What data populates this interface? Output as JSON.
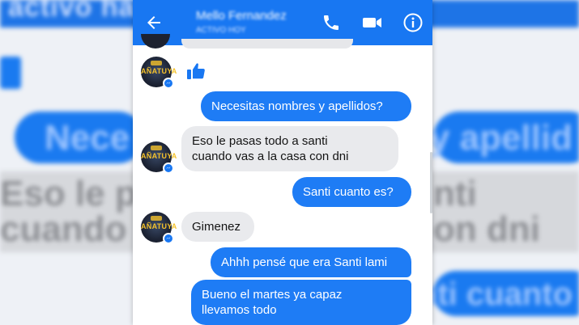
{
  "header": {
    "contact_name": "Mello Fernandez",
    "contact_status": "ACTIVO HOY"
  },
  "background": {
    "top_text": "activo hace",
    "echo_blue_left": "Nece",
    "echo_blue_right": "y apellid",
    "echo_grey_left_1": "Eso le pa",
    "echo_grey_left_2": "cuando v",
    "echo_grey_right_1": "nti",
    "echo_grey_right_2": "on dni",
    "echo_blue_right_2": "nti cuanto"
  },
  "avatar": {
    "label": "AÑATUYA"
  },
  "messages": [
    {
      "side": "in",
      "type": "like"
    },
    {
      "side": "out",
      "text": "Necesitas nombres y apellidos?"
    },
    {
      "side": "in",
      "lines": [
        "Eso le pasas todo a santi",
        "cuando vas a la casa con dni"
      ]
    },
    {
      "side": "out",
      "text": "Santi cuanto es?"
    },
    {
      "side": "in",
      "text": "Gimenez"
    },
    {
      "side": "out",
      "text": "Ahhh pensé que era Santi lami"
    },
    {
      "side": "out",
      "lines": [
        "Bueno el martes ya capaz",
        "llevamos todo"
      ]
    }
  ],
  "colors": {
    "accent": "#1877f2",
    "outgoing_bubble": "#1e7cf5",
    "incoming_bubble": "#e9eaed"
  },
  "icons": [
    "back-arrow-icon",
    "phone-icon",
    "video-camera-icon",
    "info-icon",
    "thumbs-up-icon",
    "messenger-badge-icon"
  ]
}
